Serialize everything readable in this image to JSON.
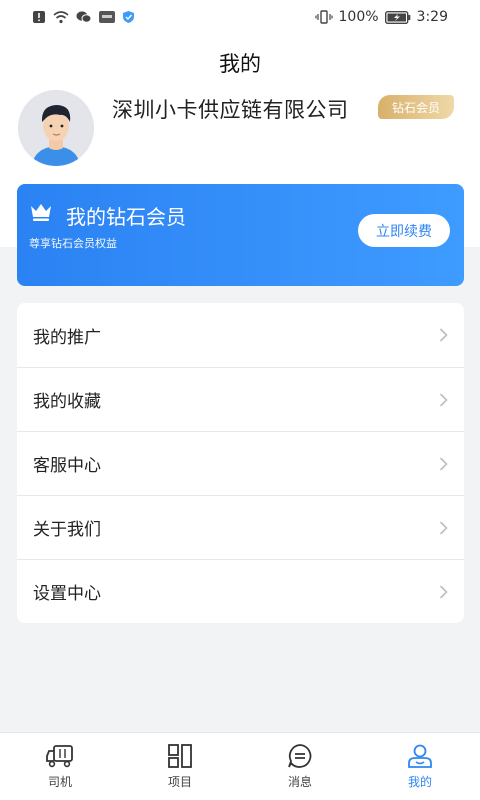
{
  "status_bar": {
    "battery": "100%",
    "time": "3:29"
  },
  "header": {
    "title": "我的"
  },
  "profile": {
    "company": "深圳小卡供应链有限公司",
    "badge": "钻石会员"
  },
  "member_card": {
    "title": "我的钻石会员",
    "subtitle": "尊享钻石会员权益",
    "renew_label": "立即续费"
  },
  "menu": {
    "items": [
      {
        "label": "我的推广"
      },
      {
        "label": "我的收藏"
      },
      {
        "label": "客服中心"
      },
      {
        "label": "关于我们"
      },
      {
        "label": "设置中心"
      }
    ]
  },
  "tabbar": {
    "tabs": [
      {
        "label": "司机",
        "icon": "truck-icon"
      },
      {
        "label": "项目",
        "icon": "grid-icon"
      },
      {
        "label": "消息",
        "icon": "message-icon"
      },
      {
        "label": "我的",
        "icon": "user-icon",
        "active": true
      }
    ]
  },
  "colors": {
    "accent": "#2f86f4",
    "badge_gold": "#d8b06a"
  }
}
